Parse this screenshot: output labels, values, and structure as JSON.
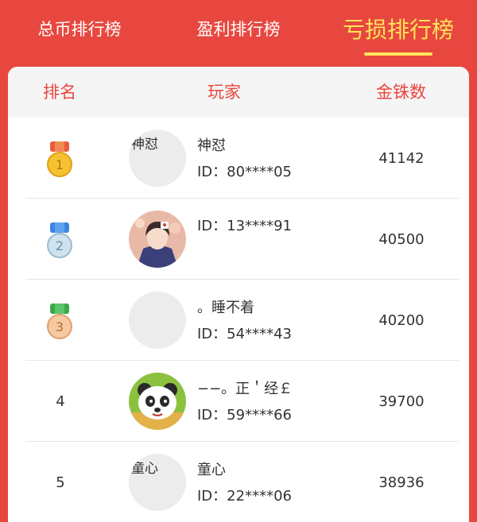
{
  "tabs": [
    {
      "label": "总币排行榜",
      "active": false
    },
    {
      "label": "盈利排行榜",
      "active": false
    },
    {
      "label": "亏损排行榜",
      "active": true
    }
  ],
  "table": {
    "headers": {
      "rank": "排名",
      "player": "玩家",
      "coins": "金铢数"
    },
    "rows": [
      {
        "rank": "1",
        "medal": "gold-medal-icon",
        "avatar_text": "神怼",
        "name": "神怼",
        "id": "ID：80****05",
        "coins": "41142"
      },
      {
        "rank": "2",
        "medal": "silver-medal-icon",
        "avatar_text": "",
        "name": "",
        "id": "ID：13****91",
        "coins": "40500"
      },
      {
        "rank": "3",
        "medal": "bronze-medal-icon",
        "avatar_text": "",
        "name": "。睡不着",
        "id": "ID：54****43",
        "coins": "40200"
      },
      {
        "rank": "4",
        "medal": "",
        "avatar_text": "",
        "name": "−−。正＇经￡",
        "id": "ID：59****66",
        "coins": "39700"
      },
      {
        "rank": "5",
        "medal": "",
        "avatar_text": "童心",
        "name": "童心",
        "id": "ID：22****06",
        "coins": "38936"
      }
    ]
  },
  "colors": {
    "background": "#e8473f",
    "active_tab": "#ffe35a",
    "header_text": "#e8473f"
  }
}
